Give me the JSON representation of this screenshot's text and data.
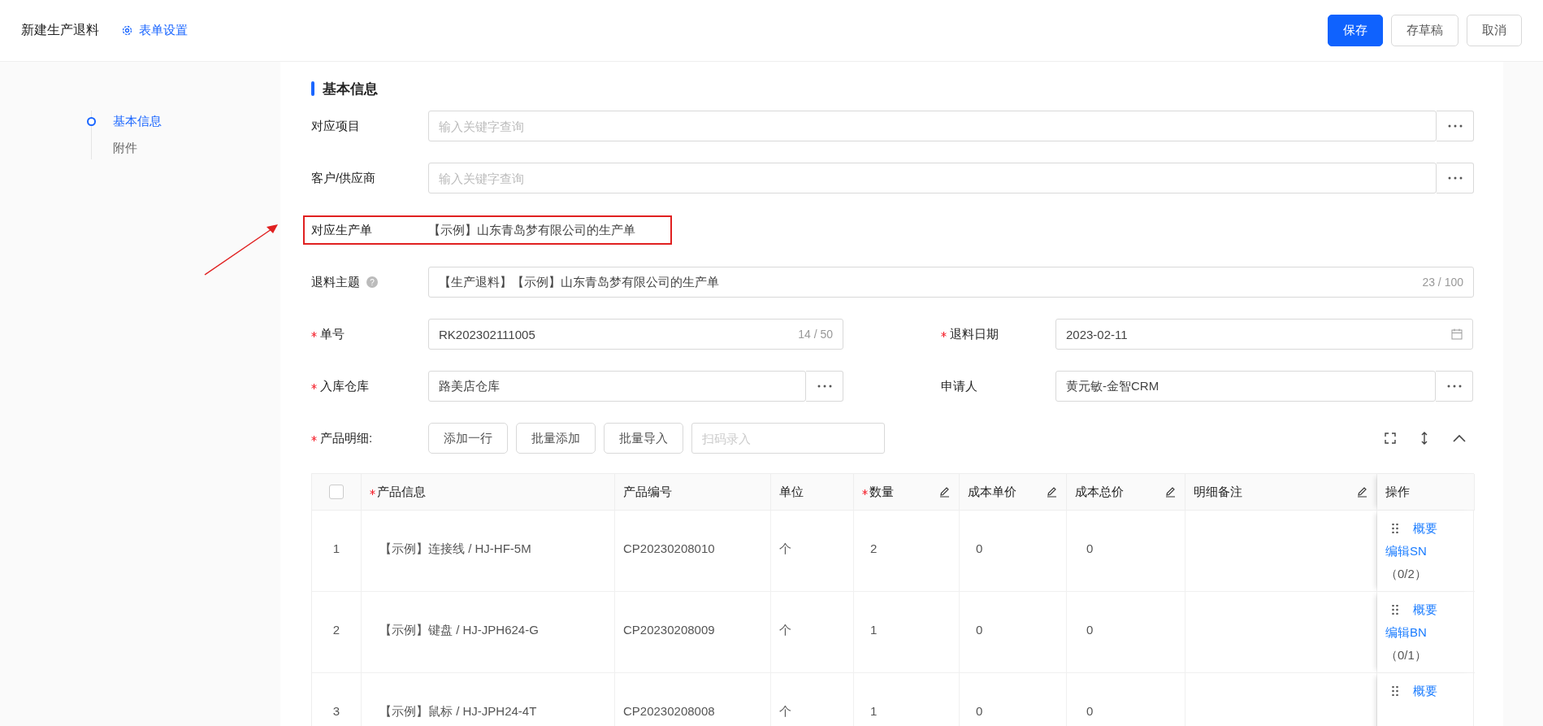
{
  "header": {
    "title": "新建生产退料",
    "settings_link": "表单设置",
    "buttons": [
      {
        "label": "保存",
        "kind": "primary"
      },
      {
        "label": "存草稿",
        "kind": "default"
      },
      {
        "label": "取消",
        "kind": "default"
      }
    ]
  },
  "nav": {
    "items": [
      {
        "label": "基本信息",
        "selected": true
      },
      {
        "label": "附件",
        "selected": false
      }
    ]
  },
  "section_title": "基本信息",
  "form_rows": [
    {
      "fields": [
        {
          "kind": "lookup",
          "label": "对应项目",
          "required": false,
          "placeholder": "输入关键字查询"
        }
      ]
    },
    {
      "fields": [
        {
          "kind": "lookup",
          "label": "客户/供应商",
          "required": false,
          "placeholder": "输入关键字查询"
        }
      ]
    },
    {
      "fields": [
        {
          "kind": "static",
          "label": "对应生产单",
          "required": false,
          "value": "【示例】山东青岛梦有限公司的生产单",
          "highlighted": true
        }
      ]
    },
    {
      "fields": [
        {
          "kind": "counter",
          "label": "退料主题",
          "required": false,
          "help": "?",
          "value": "【生产退料】【示例】山东青岛梦有限公司的生产单",
          "counter": "23 / 100"
        }
      ]
    },
    {
      "fields": [
        {
          "kind": "counter",
          "label": "单号",
          "required": true,
          "value": "RK202302111005",
          "counter": "14 / 50"
        },
        {
          "kind": "date",
          "label": "退料日期",
          "required": true,
          "value": "2023-02-11"
        }
      ]
    },
    {
      "fields": [
        {
          "kind": "lookup",
          "label": "入库仓库",
          "required": true,
          "value": "路美店仓库"
        },
        {
          "kind": "lookup",
          "label": "申请人",
          "required": false,
          "value": "黄元敏-金智CRM"
        }
      ]
    }
  ],
  "products": {
    "label": "产品明细:",
    "required": true,
    "buttons": [
      "添加一行",
      "批量添加",
      "批量导入"
    ],
    "scan_placeholder": "扫码录入",
    "select_all": {
      "checked": false
    },
    "columns": [
      {
        "label": "产品信息",
        "required": true,
        "editable": false
      },
      {
        "label": "产品编号",
        "required": false,
        "editable": false
      },
      {
        "label": "单位",
        "required": false,
        "editable": false
      },
      {
        "label": "数量",
        "required": true,
        "editable": true
      },
      {
        "label": "成本单价",
        "required": false,
        "editable": true
      },
      {
        "label": "成本总价",
        "required": false,
        "editable": true
      },
      {
        "label": "明细备注",
        "required": false,
        "editable": true
      },
      {
        "label": "操作",
        "required": false,
        "editable": false
      }
    ],
    "rows": [
      {
        "index": "1",
        "product": "【示例】连接线 / HJ-HF-5M",
        "code": "CP20230208010",
        "unit": "个",
        "qty": "2",
        "unit_cost": "0",
        "total_cost": "0",
        "summary": "概要",
        "edit_link": "编辑SN",
        "count": "（0/2）"
      },
      {
        "index": "2",
        "product": "【示例】键盘 / HJ-JPH624-G",
        "code": "CP20230208009",
        "unit": "个",
        "qty": "1",
        "unit_cost": "0",
        "total_cost": "0",
        "summary": "概要",
        "edit_link": "编辑BN",
        "count": "（0/1）"
      },
      {
        "index": "3",
        "product": "【示例】鼠标 / HJ-JPH24-4T",
        "code": "CP20230208008",
        "unit": "个",
        "qty": "1",
        "unit_cost": "0",
        "total_cost": "0",
        "summary": "概要"
      }
    ]
  }
}
